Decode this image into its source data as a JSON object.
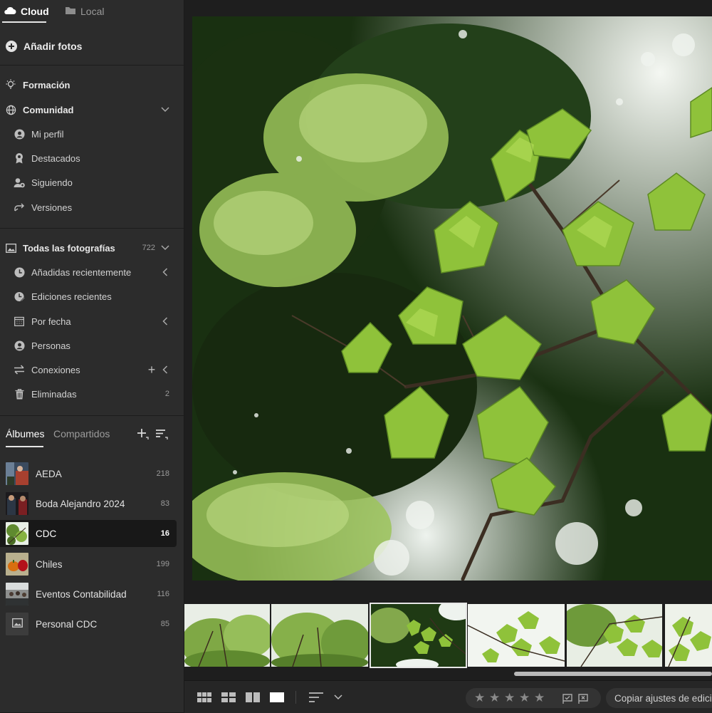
{
  "source_tabs": [
    {
      "label": "Cloud",
      "icon": "cloud-icon",
      "active": true
    },
    {
      "label": "Local",
      "icon": "folder-icon",
      "active": false
    }
  ],
  "add_photos": {
    "label": "Añadir fotos",
    "icon": "add-circle-icon"
  },
  "learn": {
    "label": "Formación",
    "icon": "lightbulb-icon"
  },
  "community": {
    "label": "Comunidad",
    "icon": "globe-icon",
    "expanded": true,
    "items": [
      {
        "label": "Mi perfil",
        "icon": "profile-icon"
      },
      {
        "label": "Destacados",
        "icon": "award-icon"
      },
      {
        "label": "Siguiendo",
        "icon": "following-icon"
      },
      {
        "label": "Versiones",
        "icon": "remix-icon"
      }
    ]
  },
  "all_photos": {
    "label": "Todas las fotografías",
    "count": "722",
    "icon": "photos-icon",
    "expanded": true,
    "items": [
      {
        "label": "Añadidas recientemente",
        "icon": "clock-icon",
        "count": ""
      },
      {
        "label": "Ediciones recientes",
        "icon": "edit-history-icon",
        "count": ""
      },
      {
        "label": "Por fecha",
        "icon": "calendar-icon",
        "count": ""
      },
      {
        "label": "Personas",
        "icon": "person-icon",
        "count": ""
      },
      {
        "label": "Conexiones",
        "icon": "connections-icon",
        "count": ""
      },
      {
        "label": "Eliminadas",
        "icon": "trash-icon",
        "count": "2"
      }
    ]
  },
  "albums_section": {
    "tabs": [
      {
        "label": "Álbumes",
        "active": true
      },
      {
        "label": "Compartidos",
        "active": false
      }
    ],
    "albums": [
      {
        "name": "AEDA",
        "count": "218",
        "selected": false
      },
      {
        "name": "Boda Alejandro 2024",
        "count": "83",
        "selected": false
      },
      {
        "name": "CDC",
        "count": "16",
        "selected": true
      },
      {
        "name": "Chiles",
        "count": "199",
        "selected": false
      },
      {
        "name": "Eventos Contabilidad",
        "count": "116",
        "selected": false
      },
      {
        "name": "Personal CDC",
        "count": "85",
        "selected": false
      }
    ]
  },
  "toolbar": {
    "view_modes": [
      "square-grid-icon",
      "photo-grid-icon",
      "compare-icon",
      "single-view-icon"
    ],
    "sort_icon": "sort-icon",
    "rating": 0,
    "copy_settings_label": "Copiar ajustes de edición"
  },
  "colors": {
    "sidebar_bg": "#2c2c2c",
    "main_bg": "#1e1e1e",
    "selected_row": "#181818",
    "leaf_green": "#8fc23a"
  }
}
